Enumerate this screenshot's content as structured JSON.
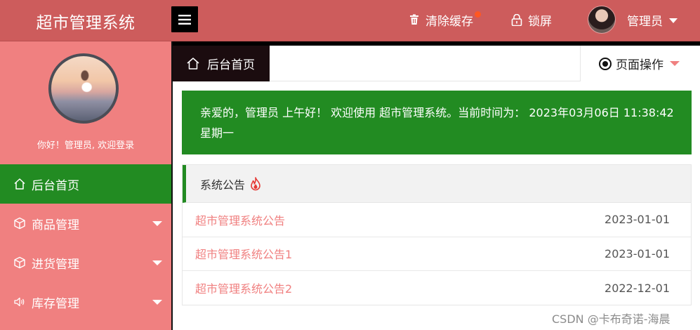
{
  "header": {
    "logo": "超市管理系统",
    "clear_cache": "清除缓存",
    "lock": "锁屏",
    "user": "管理员"
  },
  "sidebar": {
    "welcome": "你好！管理员, 欢迎登录",
    "items": [
      {
        "label": "后台首页",
        "icon": "home-icon"
      },
      {
        "label": "商品管理",
        "icon": "cube-icon"
      },
      {
        "label": "进货管理",
        "icon": "cube-icon"
      },
      {
        "label": "库存管理",
        "icon": "speaker-icon"
      }
    ]
  },
  "tabs": {
    "home": "后台首页",
    "page_ops": "页面操作"
  },
  "main": {
    "greeting": "亲爱的，管理员 上午好！ 欢迎使用 超市管理系统。当前时间为： 2023年03月06日 11:38:42　星期一",
    "notice_title": "系统公告",
    "notices": [
      {
        "title": "超市管理系统公告",
        "date": "2023-01-01"
      },
      {
        "title": "超市管理系统公告1",
        "date": "2023-01-01"
      },
      {
        "title": "超市管理系统公告2",
        "date": "2022-12-01"
      }
    ]
  },
  "watermark": "CSDN @卡布奇诺-海晨",
  "colors": {
    "header": "#cd5c5c",
    "sidebar": "#f08080",
    "active": "#228b22",
    "notice_link": "#f08080"
  }
}
